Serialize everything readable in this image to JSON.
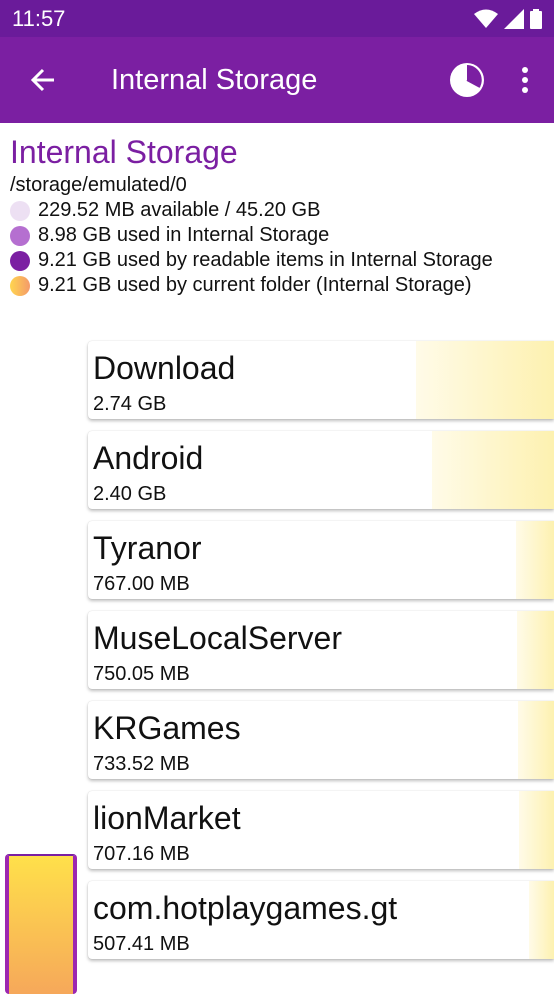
{
  "status_bar": {
    "time": "11:57"
  },
  "app_bar": {
    "title": "Internal Storage",
    "back_icon": "arrow-back-icon",
    "chart_icon": "pie-chart-icon",
    "menu_icon": "more-vert-icon"
  },
  "header": {
    "title": "Internal Storage",
    "path": "/storage/emulated/0",
    "legend": [
      {
        "text": "229.52 MB available / 45.20 GB",
        "color": "#ede0f3"
      },
      {
        "text": "8.98 GB used in Internal Storage",
        "color": "#b56fd0"
      },
      {
        "text": "9.21 GB used by readable items in Internal Storage",
        "color": "#7b1fa2"
      },
      {
        "text": "9.21 GB used by current folder (Internal Storage)",
        "color": "#f8b75a"
      }
    ]
  },
  "folders": [
    {
      "name": "Download",
      "size": "2.74 GB",
      "share": 0.297
    },
    {
      "name": "Android",
      "size": "2.40 GB",
      "share": 0.261
    },
    {
      "name": "Tyranor",
      "size": "767.00 MB",
      "share": 0.081
    },
    {
      "name": "MuseLocalServer",
      "size": "750.05 MB",
      "share": 0.079
    },
    {
      "name": "KRGames",
      "size": "733.52 MB",
      "share": 0.078
    },
    {
      "name": "lionMarket",
      "size": "707.16 MB",
      "share": 0.075
    },
    {
      "name": "com.hotplaygames.gt",
      "size": "507.41 MB",
      "share": 0.054
    }
  ]
}
